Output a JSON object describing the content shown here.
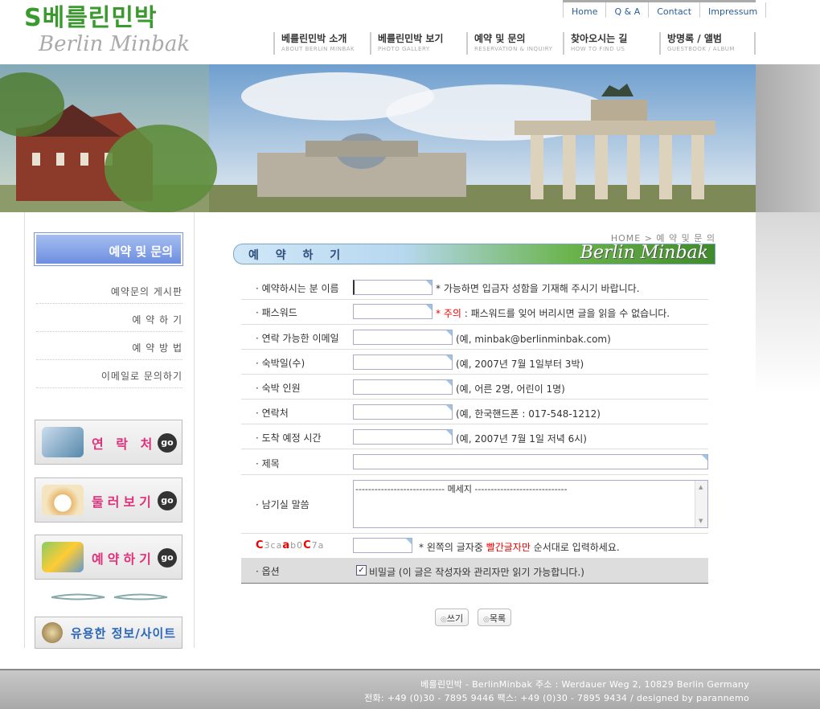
{
  "logo": {
    "korean": "S베를린민박",
    "english": "Berlin Minbak"
  },
  "top_links": [
    "Home",
    "Q & A",
    "Contact",
    "Impressum"
  ],
  "main_nav": [
    {
      "label": "베를린민박 소개",
      "sub": "ABOUT BERLIN MINBAK"
    },
    {
      "label": "베를린민박 보기",
      "sub": "PHOTO GALLERY"
    },
    {
      "label": "예약 및 문의",
      "sub": "RESERVATION & INQUIRY"
    },
    {
      "label": "찾아오시는 길",
      "sub": "HOW TO FIND US"
    },
    {
      "label": "방명록 / 앨범",
      "sub": "GUESTBOOK / ALBUM"
    }
  ],
  "sidebar": {
    "title": "예약 및 문의",
    "items": [
      "예약문의 게시판",
      "예 약 하 기",
      "예 약 방 법",
      "이메일로 문의하기"
    ],
    "buttons": [
      {
        "label": "연 락 처",
        "go": "go"
      },
      {
        "label": "둘러보기",
        "go": "go"
      },
      {
        "label": "예약하기",
        "go": "go"
      },
      {
        "label": "유용한 정보/사이트"
      }
    ]
  },
  "breadcrumb": "HOME > 예 약 및 문 의",
  "title": {
    "text": "예 약 하 기",
    "brand": "Berlin Minbak"
  },
  "form": {
    "name_label": "· 예약하시는 분 이름",
    "name_note": "* 가능하면 입금자 성함을 기재해 주시기 바랍니다.",
    "pw_label": "· 패스워드",
    "pw_note_star": "* ",
    "pw_note_warn": "주의",
    "pw_note_rest": " : 패스워드를 잊어 버리시면 글을 읽을 수 없습니다.",
    "email_label": "· 연락 가능한 이메일",
    "email_note": "(예, minbak@berlinminbak.com)",
    "date_label": "· 숙박일(수)",
    "date_note": "(예, 2007년 7월 1일부터 3박)",
    "people_label": "· 숙박 인원",
    "people_note": "(예, 어른 2명, 어린이 1명)",
    "phone_label": "· 연락처",
    "phone_note": "(예, 한국핸드폰 : 017-548-1212)",
    "arrival_label": "· 도착 예정 시간",
    "arrival_note": "(예, 2007년 7월 1일 저녁 6시)",
    "subject_label": "· 제목",
    "message_label": "· 남기실 말씀",
    "message_value": "---------------------------- 메세지 -----------------------------",
    "captcha_label": "C3cAa b0C7a",
    "captcha_note_a": "* 왼쪽의 글자중 ",
    "captcha_note_red": "빨간글자만",
    "captcha_note_b": " 순서대로 입력하세요.",
    "option_label": "· 옵션",
    "option_text": "비밀글 (이 글은 작성자와 관리자만 읽기 가능합니다.)"
  },
  "buttons": {
    "write": "쓰기",
    "list": "목록"
  },
  "footer": {
    "line1": "베를린민박 - BerlinMinbak   주소 : Werdauer Weg 2, 10829 Berlin Germany",
    "line2": "전화: +49 (0)30 - 7895 9446  팩스: +49 (0)30 - 7895 9434 / designed by parannemo"
  }
}
